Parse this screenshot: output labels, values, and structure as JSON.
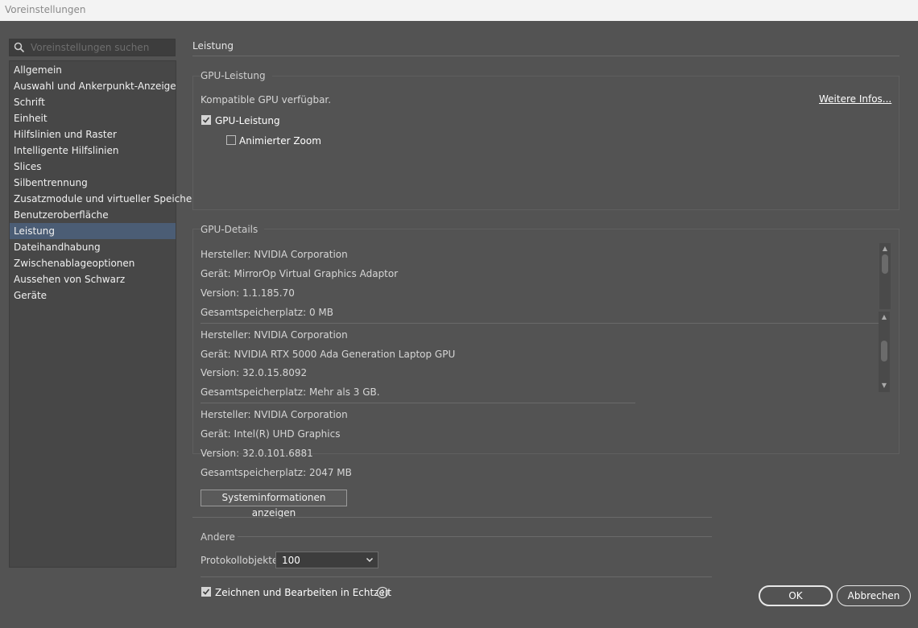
{
  "window": {
    "title": "Voreinstellungen"
  },
  "search": {
    "placeholder": "Voreinstellungen suchen"
  },
  "sidebar": {
    "items": [
      {
        "label": "Allgemein"
      },
      {
        "label": "Auswahl und Ankerpunkt-Anzeige"
      },
      {
        "label": "Schrift"
      },
      {
        "label": "Einheit"
      },
      {
        "label": "Hilfslinien und Raster"
      },
      {
        "label": "Intelligente Hilfslinien"
      },
      {
        "label": "Slices"
      },
      {
        "label": "Silbentrennung"
      },
      {
        "label": "Zusatzmodule und virtueller Speicher"
      },
      {
        "label": "Benutzeroberfläche"
      },
      {
        "label": "Leistung"
      },
      {
        "label": "Dateihandhabung"
      },
      {
        "label": "Zwischenablageoptionen"
      },
      {
        "label": "Aussehen von Schwarz"
      },
      {
        "label": "Geräte"
      }
    ],
    "selected": "Leistung"
  },
  "main": {
    "section_title": "Leistung",
    "gpu_performance": {
      "group_label": "GPU-Leistung",
      "status_text": "Kompatible GPU verfügbar.",
      "more_info_link": "Weitere Infos...",
      "gpu_checkbox_label": "GPU-Leistung",
      "gpu_checkbox_checked": true,
      "zoom_checkbox_label": "Animierter Zoom",
      "zoom_checkbox_checked": false
    },
    "gpu_details": {
      "group_label": "GPU-Details",
      "gpus": [
        {
          "vendor": "Hersteller: NVIDIA Corporation",
          "device": "Gerät: MirrorOp Virtual Graphics Adaptor",
          "version": "Version: 1.1.185.70",
          "memory": "Gesamtspeicherplatz: 0 MB"
        },
        {
          "vendor": "Hersteller: NVIDIA Corporation",
          "device": "Gerät: NVIDIA RTX 5000 Ada Generation Laptop GPU",
          "version": "Version: 32.0.15.8092",
          "memory": "Gesamtspeicherplatz:  Mehr als 3 GB."
        },
        {
          "vendor": "Hersteller: NVIDIA Corporation",
          "device": "Gerät: Intel(R) UHD Graphics",
          "version": "Version: 32.0.101.6881",
          "memory": "Gesamtspeicherplatz: 2047 MB"
        }
      ],
      "sysinfo_button": "Systeminformationen anzeigen"
    },
    "other": {
      "group_label": "Andere",
      "history_label": "Protokollobjekte:",
      "history_value": "100",
      "realtime_label": "Zeichnen und Bearbeiten in Echtzeit",
      "realtime_checked": true
    }
  },
  "footer": {
    "ok_label": "OK",
    "cancel_label": "Abbrechen"
  },
  "colors": {
    "background": "#535353",
    "sidebar_bg": "#474747",
    "selected_item": "#4b5d75",
    "titlebar": "#f3f3f3"
  },
  "icons": {
    "search": "search-icon",
    "dropdown": "chevron-down-icon",
    "info": "info-icon"
  }
}
